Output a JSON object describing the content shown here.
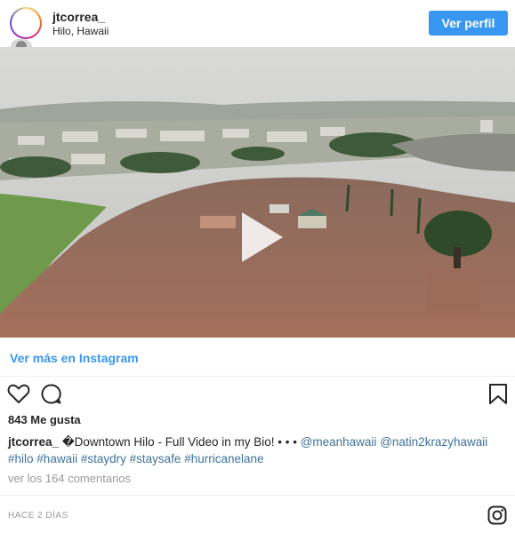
{
  "header": {
    "username": "jtcorrea_",
    "location": "Hilo, Hawaii",
    "profile_button": "Ver perfil"
  },
  "media": {
    "type": "video",
    "play_icon": "play-icon"
  },
  "more_link": "Ver más en Instagram",
  "actions": {
    "like_icon": "heart-icon",
    "comment_icon": "comment-icon",
    "save_icon": "bookmark-icon"
  },
  "likes": "843 Me gusta",
  "caption": {
    "user": "jtcorrea_",
    "text": "�Downtown Hilo - Full Video in my Bio! • • • ",
    "mentions": [
      "@meanhawaii",
      "@natin2krazyhawaii"
    ],
    "hashtags": [
      "#hilo",
      "#hawaii",
      "#staydry",
      "#staysafe",
      "#hurricanelane"
    ]
  },
  "comments_link": "ver los 164 comentarios",
  "timestamp": "HACE 2 DÍAS",
  "footer_icon": "instagram-icon",
  "colors": {
    "accent_blue": "#3897f0",
    "link_blue": "#3f729b",
    "muted": "#999999",
    "text": "#262626"
  }
}
